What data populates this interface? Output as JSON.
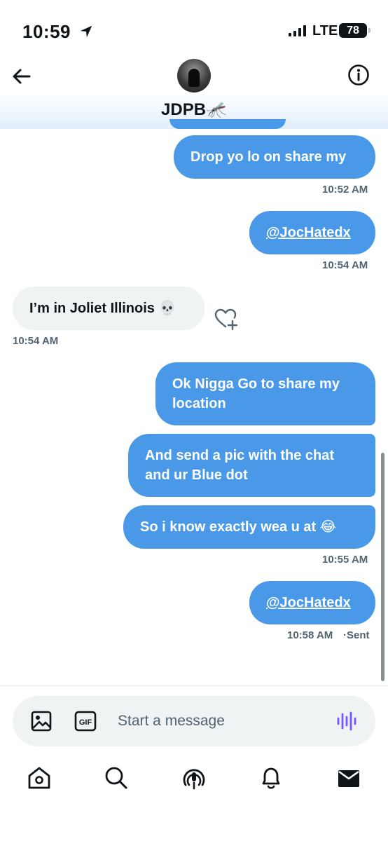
{
  "status": {
    "time": "10:59",
    "network": "LTE",
    "battery": "78"
  },
  "header": {
    "contact_name": "JDPB🦟"
  },
  "messages": [
    {
      "direction": "sent",
      "text": "Drop yo lo on share my",
      "time": "10:52 AM"
    },
    {
      "direction": "sent",
      "text": "@JocHatedx",
      "time": "10:54 AM"
    },
    {
      "direction": "received",
      "text": "I’m in Joliet Illinois 💀",
      "time": "10:54 AM"
    },
    {
      "direction": "sent",
      "text": "Ok Nigga Go to share my location"
    },
    {
      "direction": "sent",
      "text": "And send a pic with the chat and ur Blue dot"
    },
    {
      "direction": "sent",
      "text": "So i know exactly wea u at 😂",
      "time": "10:55 AM"
    },
    {
      "direction": "sent",
      "text": "@JocHatedx",
      "time": "10:58 AM",
      "status": "Sent"
    }
  ],
  "composer": {
    "placeholder": "Start a message",
    "gif_label": "GIF"
  },
  "tabbar": {
    "items": [
      "home-icon",
      "search-icon",
      "spaces-icon",
      "notifications-icon",
      "messages-icon"
    ]
  },
  "colors": {
    "sent_bubble": "#4a99e9",
    "received_bubble": "#eff3f4",
    "voice_accent": "#7856ff",
    "secondary_text": "#536471"
  }
}
